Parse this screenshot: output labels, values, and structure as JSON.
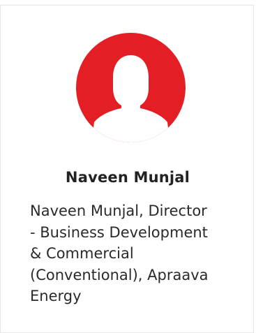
{
  "profile": {
    "avatar_icon": "user-silhouette-icon",
    "accent_color": "#e31e24",
    "name": "Naveen Munjal",
    "bio_lines": [
      "Naveen Munjal, Director",
      "- Business Development",
      "& Commercial",
      "(Conventional), Apraava",
      "Energy"
    ]
  }
}
